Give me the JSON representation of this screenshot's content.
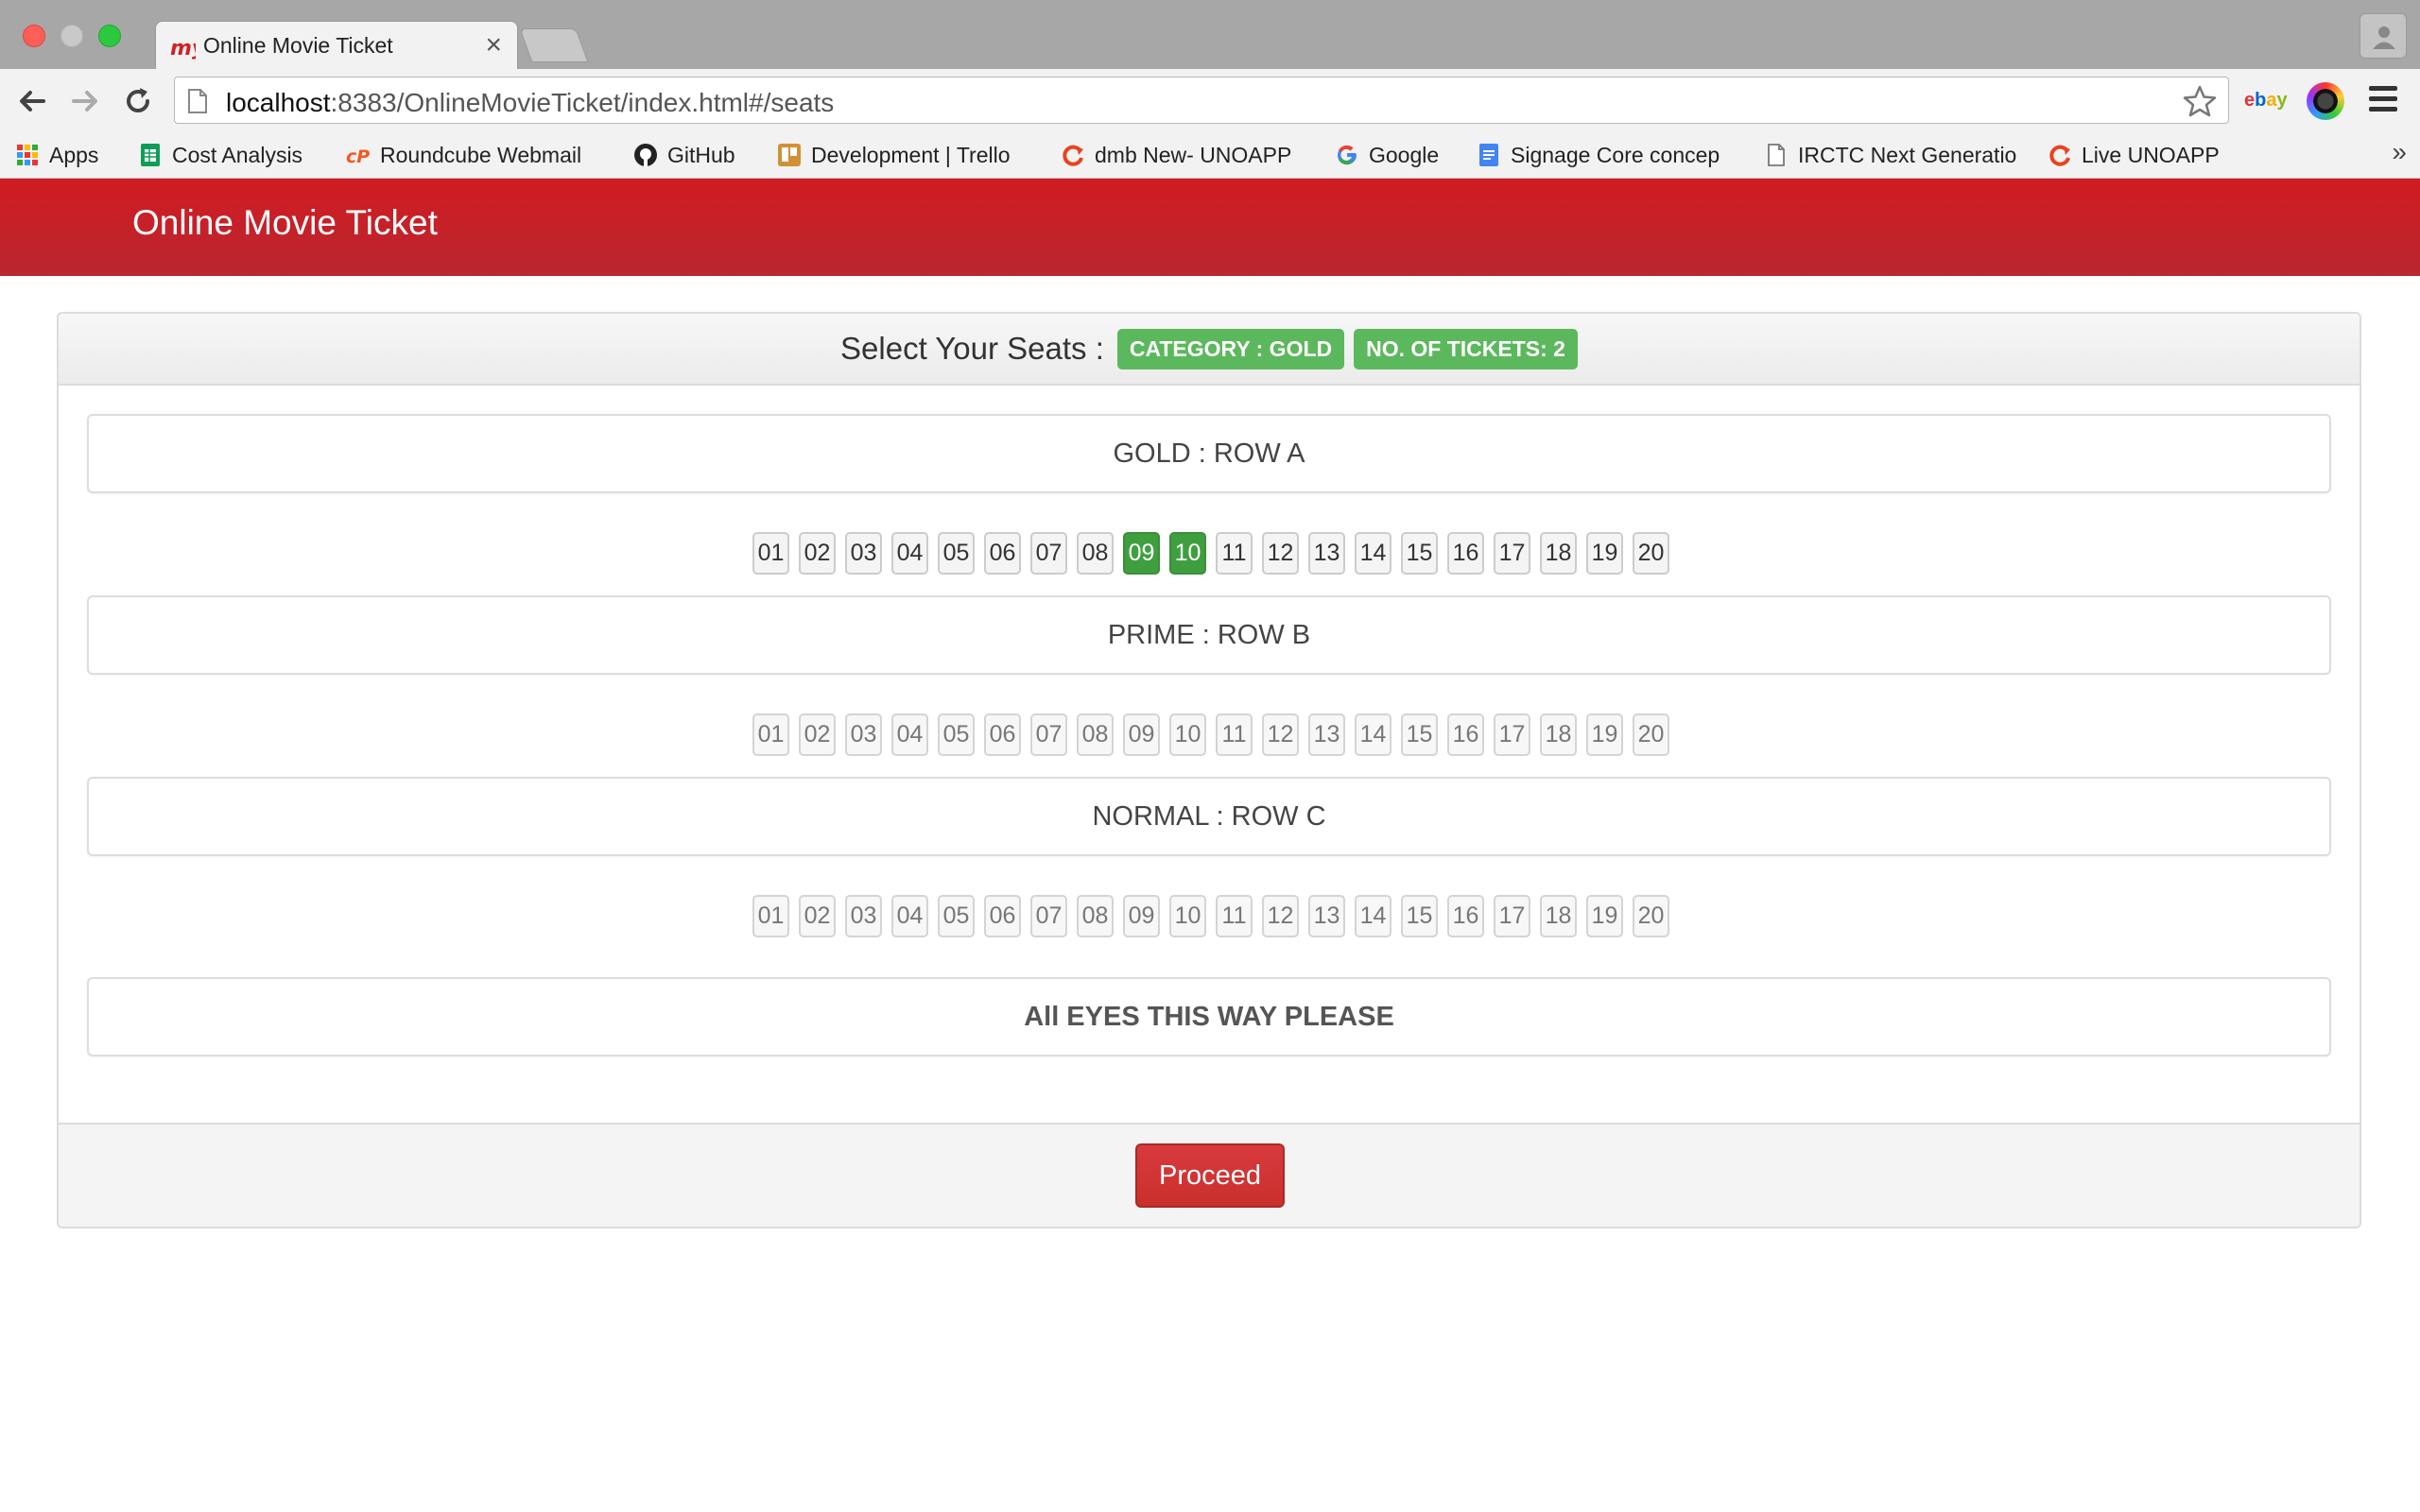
{
  "browser": {
    "tab_title": "Online Movie Ticket",
    "tab_close": "×",
    "url_host": "localhost",
    "url_rest": ":8383/OnlineMovieTicket/index.html#/seats",
    "ext_ebay": "ebay",
    "bookmarks": [
      {
        "label": "Apps",
        "icon": "apps-grid-icon"
      },
      {
        "label": "Cost Analysis",
        "icon": "sheets-icon"
      },
      {
        "label": "Roundcube Webmail",
        "icon": "cpanel-icon"
      },
      {
        "label": "GitHub",
        "icon": "github-icon"
      },
      {
        "label": "Development | Trello",
        "icon": "trello-icon"
      },
      {
        "label": "dmb New- UNOAPP",
        "icon": "unoapp-icon"
      },
      {
        "label": "Google",
        "icon": "google-icon"
      },
      {
        "label": "Signage Core concep",
        "icon": "docs-icon"
      },
      {
        "label": "IRCTC Next Generatio",
        "icon": "page-icon"
      },
      {
        "label": "Live UNOAPP",
        "icon": "unoapp-icon"
      }
    ],
    "bookmarks_more": "»"
  },
  "header": {
    "title": "Online Movie Ticket"
  },
  "seat_panel": {
    "heading": "Select Your Seats :",
    "category_badge": "CATEGORY : GOLD",
    "tickets_badge": "NO. OF TICKETS: 2",
    "rows": [
      {
        "label": "GOLD : ROW A",
        "selected": [
          "09",
          "10"
        ],
        "seats": [
          "01",
          "02",
          "03",
          "04",
          "05",
          "06",
          "07",
          "08",
          "09",
          "10",
          "11",
          "12",
          "13",
          "14",
          "15",
          "16",
          "17",
          "18",
          "19",
          "20"
        ]
      },
      {
        "label": "PRIME : ROW B",
        "selected": [],
        "seats": [
          "01",
          "02",
          "03",
          "04",
          "05",
          "06",
          "07",
          "08",
          "09",
          "10",
          "11",
          "12",
          "13",
          "14",
          "15",
          "16",
          "17",
          "18",
          "19",
          "20"
        ]
      },
      {
        "label": "NORMAL : ROW C",
        "selected": [],
        "seats": [
          "01",
          "02",
          "03",
          "04",
          "05",
          "06",
          "07",
          "08",
          "09",
          "10",
          "11",
          "12",
          "13",
          "14",
          "15",
          "16",
          "17",
          "18",
          "19",
          "20"
        ]
      }
    ],
    "screen_label": "All EYES THIS WAY PLEASE",
    "proceed_label": "Proceed"
  },
  "colors": {
    "header_red": "#c4212a",
    "badge_green": "#5cb85c",
    "selected_seat": "#3f9f3f",
    "proceed_red": "#d0343a"
  }
}
